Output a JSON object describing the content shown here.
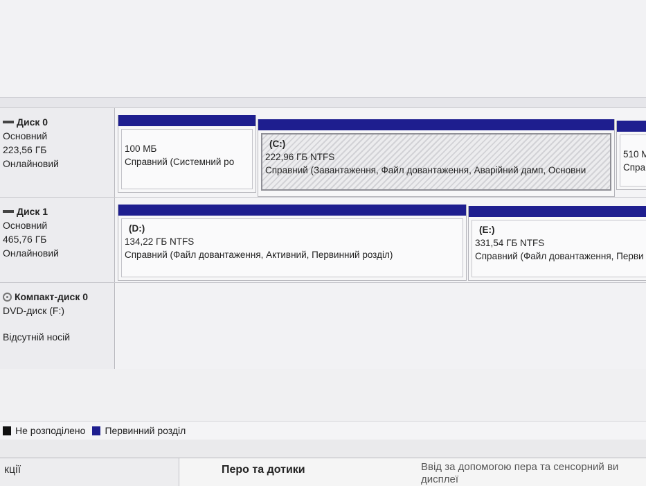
{
  "disks": [
    {
      "name": "Диск 0",
      "type": "Основний",
      "size": "223,56 ГБ",
      "status": "Онлайновий",
      "icon": "disk-icon",
      "partitions": [
        {
          "letter": "",
          "size": "100 МБ",
          "status": "Справний (Системний ро"
        },
        {
          "letter": "(C:)",
          "size": "222,96 ГБ NTFS",
          "status": "Справний (Завантаження, Файл довантаження, Аварійний дамп, Основни"
        },
        {
          "letter": "",
          "size": "510 М",
          "status": "Спра"
        }
      ]
    },
    {
      "name": "Диск 1",
      "type": "Основний",
      "size": "465,76 ГБ",
      "status": "Онлайновий",
      "icon": "disk-icon",
      "partitions": [
        {
          "letter": "(D:)",
          "size": "134,22 ГБ NTFS",
          "status": "Справний (Файл довантаження, Активний, Первинний розділ)"
        },
        {
          "letter": "(E:)",
          "size": "331,54 ГБ NTFS",
          "status": "Справний (Файл довантаження, Перви"
        }
      ]
    },
    {
      "name": "Компакт-диск 0",
      "type": "DVD-диск (F:)",
      "status": "Відсутній носій",
      "icon": "cd-icon"
    }
  ],
  "legend": {
    "unallocated": "Не розподілено",
    "primary": "Первинний розділ",
    "colors": {
      "unallocated": "#111111",
      "primary": "#1e1e8f"
    }
  },
  "bottom": {
    "left_fragment": "кції",
    "title": "Перо та дотики",
    "description": "Ввід за допомогою пера та сенсорний ви дисплеї"
  }
}
